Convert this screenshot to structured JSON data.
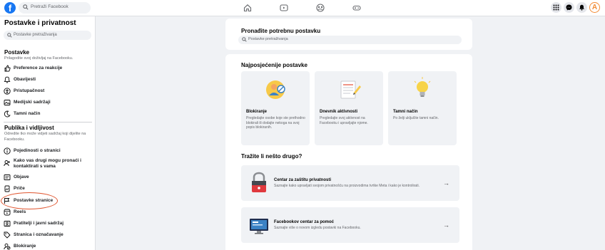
{
  "topbar": {
    "logo": "f",
    "search_placeholder": "Pretraži Facebook",
    "nav_icons": [
      "home-icon",
      "video-icon",
      "groups-icon",
      "gaming-icon"
    ],
    "right_icons": [
      "menu-grid-icon",
      "messenger-icon",
      "notifications-icon"
    ],
    "avatar_letter": "A"
  },
  "sidebar": {
    "title": "Postavke i privatnost",
    "search_placeholder": "Postavke pretraživanja",
    "section1": {
      "title": "Postavke",
      "desc": "Prilagodite svoj doživljaj na Facebooku.",
      "items": [
        {
          "label": "Preference za reakcije",
          "icon": "reactions-icon"
        },
        {
          "label": "Obavijesti",
          "icon": "bell-icon"
        },
        {
          "label": "Pristupačnost",
          "icon": "accessibility-icon"
        },
        {
          "label": "Medijski sadržaji",
          "icon": "media-icon"
        },
        {
          "label": "Tamni način",
          "icon": "moon-icon"
        }
      ]
    },
    "section2": {
      "title": "Publika i vidljivost",
      "desc": "Odredite tko može vidjeti sadržaj koji dijelite na Facebooku.",
      "items": [
        {
          "label": "Pojedinosti o stranici",
          "icon": "info-icon"
        },
        {
          "label": "Kako vas drugi mogu pronaći i kontaktirati s vama",
          "icon": "contact-icon"
        },
        {
          "label": "Objave",
          "icon": "posts-icon"
        },
        {
          "label": "Priče",
          "icon": "stories-icon"
        },
        {
          "label": "Postavke stranice",
          "icon": "page-settings-icon"
        },
        {
          "label": "Reels",
          "icon": "reels-icon"
        },
        {
          "label": "Pratitelji i javni sadržaj",
          "icon": "followers-icon"
        },
        {
          "label": "Stranica i označavanje",
          "icon": "tag-icon"
        },
        {
          "label": "Blokiranje",
          "icon": "block-icon"
        }
      ]
    }
  },
  "main": {
    "find_title": "Pronađite potrebnu postavku",
    "find_placeholder": "Postavke pretraživanja",
    "frequent_title": "Najposjećenije postavke",
    "tiles": [
      {
        "title": "Blokiranje",
        "desc": "Pregledajte osobe koje ste prethodno blokirali ili dodajte nekoga na svoj popis blokiranih."
      },
      {
        "title": "Dnevnik aktivnosti",
        "desc": "Pregledajte svoj aktivnost na Facebooku i upravljajte njome."
      },
      {
        "title": "Tamni način",
        "desc": "Po želji uključite tamni način."
      }
    ],
    "more_title": "Tražite li nešto drugo?",
    "rows": [
      {
        "title": "Centar za zaštitu privatnosti",
        "desc": "Saznajte kako upravljati svojom privatnošću na proizvodima tvrtke Meta i kako je kontrolirati.",
        "arrow": "→"
      },
      {
        "title": "Facebookov centar za pomoć",
        "desc": "Saznajte više o novom izgledu postavki na Facebooku.",
        "arrow": "→"
      }
    ]
  }
}
